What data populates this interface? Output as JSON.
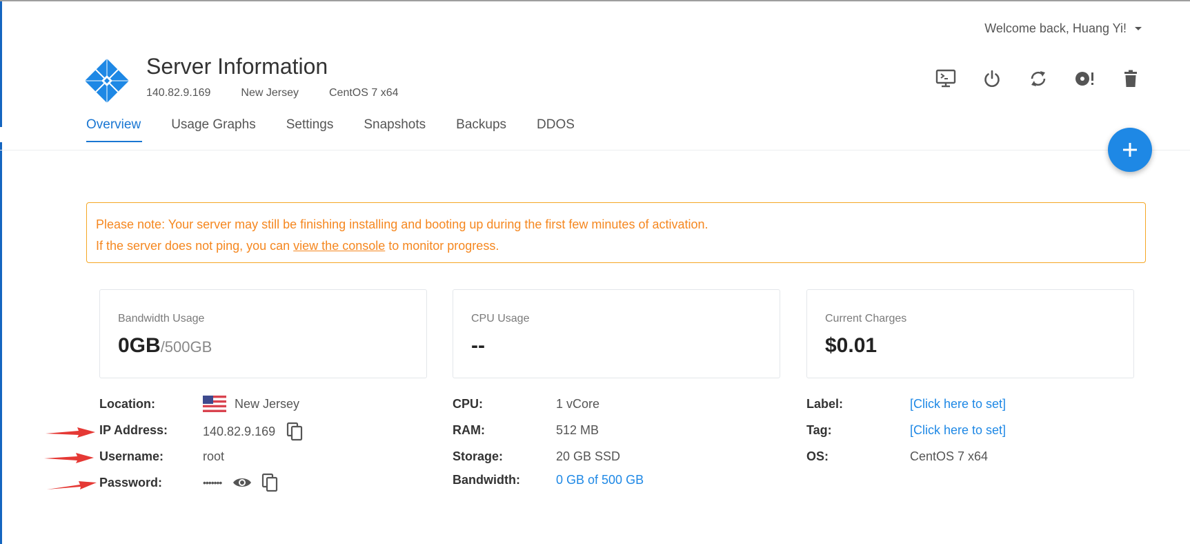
{
  "header": {
    "welcome_text": "Welcome back, Huang Yi!",
    "title": "Server Information",
    "ip": "140.82.9.169",
    "location": "New Jersey",
    "os": "CentOS 7 x64"
  },
  "actions": [
    {
      "name": "console-icon"
    },
    {
      "name": "power-icon"
    },
    {
      "name": "restart-icon"
    },
    {
      "name": "reinstall-icon"
    },
    {
      "name": "trash-icon"
    }
  ],
  "tabs": [
    "Overview",
    "Usage Graphs",
    "Settings",
    "Snapshots",
    "Backups",
    "DDOS"
  ],
  "active_tab": "Overview",
  "notice": {
    "line1": "Please note: Your server may still be finishing installing and booting up during the first few minutes of activation.",
    "line2_before": "If the server does not ping, you can ",
    "line2_link": "view the console",
    "line2_after": " to monitor progress."
  },
  "cards": [
    {
      "label": "Bandwidth Usage",
      "value": "0GB",
      "sub": "/500GB"
    },
    {
      "label": "CPU Usage",
      "value": "--",
      "sub": ""
    },
    {
      "label": "Current Charges",
      "value": "$0.01",
      "sub": ""
    }
  ],
  "details": {
    "col1": [
      {
        "label": "Location:",
        "value": "New Jersey"
      },
      {
        "label": "IP Address:",
        "value": "140.82.9.169"
      },
      {
        "label": "Username:",
        "value": "root"
      },
      {
        "label": "Password:",
        "value": "•••••••"
      }
    ],
    "col2": [
      {
        "label": "CPU:",
        "value": "1 vCore"
      },
      {
        "label": "RAM:",
        "value": "512 MB"
      },
      {
        "label": "Storage:",
        "value": "20 GB SSD"
      },
      {
        "label": "Bandwidth:",
        "value": "0 GB of 500 GB"
      }
    ],
    "col3": [
      {
        "label": "Label:",
        "value": "[Click here to set]"
      },
      {
        "label": "Tag:",
        "value": "[Click here to set]"
      },
      {
        "label": "OS:",
        "value": "CentOS 7 x64"
      }
    ]
  },
  "colors": {
    "accent": "#1e88e5",
    "notice": "#f5871f",
    "annotation_arrow": "#e53935"
  }
}
